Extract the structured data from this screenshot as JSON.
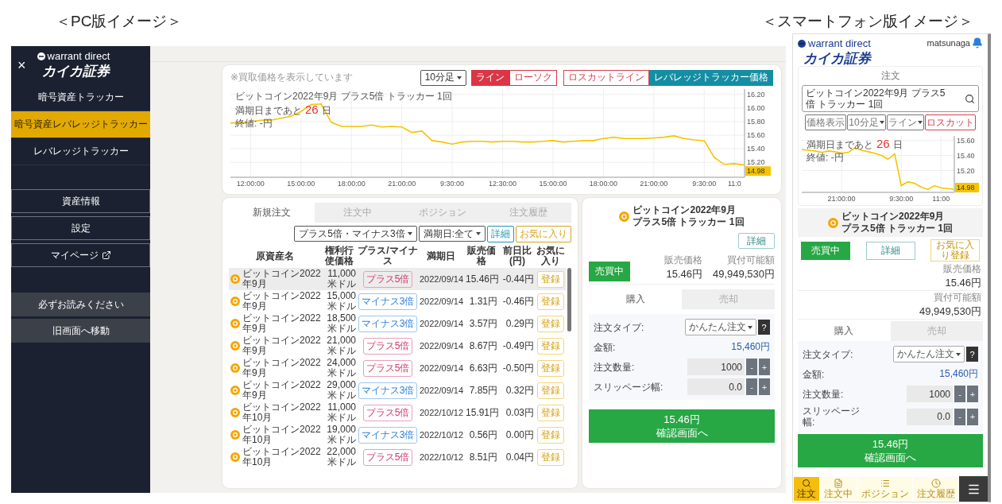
{
  "pc_heading": "＜PC版イメージ＞",
  "sp_heading": "＜スマートフォン版イメージ＞",
  "pc": {
    "sidebar": {
      "close": "×",
      "logo_top": "warrant direct",
      "logo_name": "カイカ証券",
      "nav": [
        {
          "label": "暗号資産トラッカー",
          "selected": false
        },
        {
          "label": "暗号資産レバレッジトラッカー",
          "selected": true
        },
        {
          "label": "レバレッジトラッカー",
          "selected": false
        }
      ],
      "menu": [
        {
          "label": "資産情報",
          "kind": "plain"
        },
        {
          "label": "設定",
          "kind": "plain"
        },
        {
          "label": "マイページ",
          "kind": "external"
        }
      ],
      "links": [
        "必ずお読みください",
        "旧画面へ移動"
      ]
    },
    "chart_card": {
      "note": "※買取価格を表示しています",
      "interval": "10分足",
      "styles": [
        {
          "label": "ライン",
          "selected": true
        },
        {
          "label": "ローソク",
          "selected": false
        }
      ],
      "lines": [
        {
          "label": "ロスカットライン",
          "selected": false
        },
        {
          "label": "レバレッジトラッカー価格",
          "selected": true
        }
      ],
      "title": "ビットコイン2022年9月 プラス5倍 トラッカー 1回",
      "remaining": {
        "before": "満期日まであと",
        "days": "26",
        "after": "日"
      },
      "close": "終値: -円",
      "chart_data": {
        "type": "line",
        "categories": [
          null,
          null,
          "12:00:00",
          null,
          null,
          null,
          null,
          "15:00:00",
          null,
          null,
          null,
          null,
          "18:00:00",
          null,
          null,
          null,
          null,
          "21:00:00",
          null,
          null,
          null,
          null,
          "9:30:00",
          null,
          null,
          null,
          null,
          "12:30:00",
          null,
          null,
          null,
          null,
          "15:00:00",
          null,
          null,
          null,
          null,
          "18:00:00",
          null,
          null,
          null,
          null,
          "21:00:00",
          null,
          null,
          null,
          null,
          "9:30:00",
          null,
          null,
          "11:0",
          null
        ],
        "values": [
          15.78,
          15.78,
          15.8,
          15.82,
          15.82,
          15.85,
          15.88,
          15.95,
          16.05,
          16.06,
          15.79,
          15.73,
          15.73,
          15.73,
          15.75,
          15.72,
          15.73,
          15.72,
          15.64,
          15.66,
          15.52,
          15.5,
          15.47,
          15.5,
          15.51,
          15.51,
          15.5,
          15.51,
          15.51,
          15.5,
          15.5,
          15.51,
          15.52,
          15.5,
          15.51,
          15.52,
          15.52,
          15.55,
          15.57,
          15.55,
          15.55,
          15.55,
          15.56,
          15.57,
          15.59,
          15.55,
          15.53,
          15.52,
          15.27,
          15.17,
          15.18,
          15.16
        ],
        "ylim": [
          14.98,
          16.28
        ],
        "grid": true,
        "yticks": [
          {
            "value": 15.2,
            "label": "15.20"
          },
          {
            "value": 15.4,
            "label": "15.40"
          },
          {
            "value": 15.6,
            "label": "15.60"
          },
          {
            "value": 15.8,
            "label": "15.80"
          },
          {
            "value": 16.0,
            "label": "16.00"
          },
          {
            "value": 16.2,
            "label": "16.20"
          }
        ],
        "annotations": [
          "14.98"
        ]
      }
    },
    "table_card": {
      "tabs": [
        {
          "label": "新規注文",
          "selected": true
        },
        {
          "label": "注文中",
          "selected": false
        },
        {
          "label": "ポジション",
          "selected": false
        },
        {
          "label": "注文履歴",
          "selected": false
        }
      ],
      "filters": {
        "type": "プラス5倍・マイナス3倍",
        "expiry": "満期日:全て",
        "detail": "詳細",
        "favorite": "お気に入り"
      },
      "columns": [
        "原資産名",
        "権利行使価格",
        "プラス/マイナス",
        "満期日",
        "販売価格",
        "前日比(円)",
        "お気に入り"
      ],
      "rows": [
        {
          "name": "ビットコイン2022年9月",
          "strike": "11,000米ドル",
          "type": {
            "label": "プラス5倍",
            "kind": "plus"
          },
          "expiry": "2022/09/14",
          "price": "15.46円",
          "change": "-0.44円",
          "favorite": "登録",
          "selected": true
        },
        {
          "name": "ビットコイン2022年9月",
          "strike": "15,000米ドル",
          "type": {
            "label": "マイナス3倍",
            "kind": "minus"
          },
          "expiry": "2022/09/14",
          "price": "1.31円",
          "change": "-0.46円",
          "favorite": "登録",
          "selected": false
        },
        {
          "name": "ビットコイン2022年9月",
          "strike": "18,500米ドル",
          "type": {
            "label": "マイナス3倍",
            "kind": "minus"
          },
          "expiry": "2022/09/14",
          "price": "3.57円",
          "change": "0.29円",
          "favorite": "登録",
          "selected": false
        },
        {
          "name": "ビットコイン2022年9月",
          "strike": "21,000米ドル",
          "type": {
            "label": "プラス5倍",
            "kind": "plus"
          },
          "expiry": "2022/09/14",
          "price": "8.67円",
          "change": "-0.49円",
          "favorite": "登録",
          "selected": false
        },
        {
          "name": "ビットコイン2022年9月",
          "strike": "24,000米ドル",
          "type": {
            "label": "プラス5倍",
            "kind": "plus"
          },
          "expiry": "2022/09/14",
          "price": "6.63円",
          "change": "-0.50円",
          "favorite": "登録",
          "selected": false
        },
        {
          "name": "ビットコイン2022年9月",
          "strike": "29,000米ドル",
          "type": {
            "label": "マイナス3倍",
            "kind": "minus"
          },
          "expiry": "2022/09/14",
          "price": "7.85円",
          "change": "0.32円",
          "favorite": "登録",
          "selected": false
        },
        {
          "name": "ビットコイン2022年10月",
          "strike": "11,000米ドル",
          "type": {
            "label": "プラス5倍",
            "kind": "plus"
          },
          "expiry": "2022/10/12",
          "price": "15.91円",
          "change": "0.03円",
          "favorite": "登録",
          "selected": false
        },
        {
          "name": "ビットコイン2022年10月",
          "strike": "19,000米ドル",
          "type": {
            "label": "マイナス3倍",
            "kind": "minus"
          },
          "expiry": "2022/10/12",
          "price": "0.56円",
          "change": "0.00円",
          "favorite": "登録",
          "selected": false
        },
        {
          "name": "ビットコイン2022年10月",
          "strike": "22,000米ドル",
          "type": {
            "label": "プラス5倍",
            "kind": "plus"
          },
          "expiry": "2022/10/12",
          "price": "8.51円",
          "change": "0.04円",
          "favorite": "登録",
          "selected": false
        }
      ]
    },
    "order_card": {
      "title": [
        "ビットコイン2022年9月",
        "プラス5倍 トラッカー 1回"
      ],
      "detail": "詳細",
      "status": "売買中",
      "stats": [
        {
          "label": "販売価格",
          "value": "15.46円"
        },
        {
          "label": "買付可能額",
          "value": "49,949,530円"
        }
      ],
      "tabs": [
        {
          "label": "購入",
          "selected": true
        },
        {
          "label": "売却",
          "selected": false
        }
      ],
      "form": [
        {
          "kind": "select",
          "label": "注文タイプ:",
          "value": "かんたん注文",
          "help": "?"
        },
        {
          "kind": "amount",
          "label": "金額:",
          "value": "15,460円"
        },
        {
          "kind": "stepper",
          "label": "注文数量:",
          "value": "1000",
          "minus": "-",
          "plus": "+"
        },
        {
          "kind": "stepper",
          "label": "スリッページ幅:",
          "value": "0.0",
          "minus": "-",
          "plus": "+"
        }
      ],
      "submit": {
        "price": "15.46円",
        "label": "確認画面へ"
      }
    }
  },
  "sp": {
    "logo_top": "warrant direct",
    "logo_name": "カイカ証券",
    "user": "matsunaga",
    "section": "注文",
    "search": "ビットコイン2022年9月 プラス5倍 トラッカー 1回",
    "toolbar": [
      {
        "label": "価格表示",
        "kind": "plain"
      },
      {
        "label": "10分足",
        "kind": "dropdown"
      },
      {
        "label": "ライン",
        "kind": "dropdown"
      },
      {
        "label": "ロスカット",
        "kind": "alert"
      }
    ],
    "remaining": {
      "before": "満期日まであと",
      "days": "26",
      "after": "日"
    },
    "close": "終値: -円",
    "chart_data": {
      "type": "line",
      "categories": [
        null,
        null,
        null,
        null,
        null,
        null,
        "21:00:00",
        null,
        null,
        null,
        null,
        null,
        null,
        null,
        null,
        "9:30:00",
        null,
        null,
        null,
        null,
        null,
        "11:00",
        null,
        null
      ],
      "values": [
        15.48,
        15.47,
        15.46,
        15.44,
        15.46,
        15.45,
        15.43,
        15.44,
        15.5,
        15.47,
        15.45,
        15.43,
        15.4,
        15.35,
        15.42,
        15.0,
        15.05,
        15.03,
        14.98,
        14.95,
        15.0,
        14.97,
        14.96,
        14.95
      ],
      "ylim": [
        14.91,
        15.66
      ],
      "grid": true,
      "yticks": [
        {
          "value": 15.2,
          "label": "15.20"
        },
        {
          "value": 15.4,
          "label": "15.40"
        },
        {
          "value": 15.6,
          "label": "15.60"
        }
      ],
      "annotations": [
        "14.98"
      ]
    },
    "title": [
      "ビットコイン2022年9月",
      "プラス5倍 トラッカー 1回"
    ],
    "status": "売買中",
    "detail": "詳細",
    "favorite": "お気に入り登録",
    "stats": [
      {
        "label": "販売価格",
        "value": "15.46円"
      },
      {
        "label": "買付可能額",
        "value": "49,949,530円"
      }
    ],
    "tabs": [
      {
        "label": "購入",
        "selected": true
      },
      {
        "label": "売却",
        "selected": false
      }
    ],
    "form": [
      {
        "kind": "select",
        "label": "注文タイプ:",
        "value": "かんたん注文",
        "help": "?"
      },
      {
        "kind": "amount",
        "label": "金額:",
        "value": "15,460円"
      },
      {
        "kind": "stepper",
        "label": "注文数量:",
        "value": "1000",
        "minus": "-",
        "plus": "+"
      },
      {
        "kind": "stepper",
        "label": "スリッページ幅:",
        "value": "0.0",
        "minus": "-",
        "plus": "+"
      }
    ],
    "submit": {
      "price": "15.46円",
      "label": "確認画面へ"
    },
    "nav": [
      {
        "label": "注文",
        "selected": true
      },
      {
        "label": "注文中",
        "selected": false
      },
      {
        "label": "ポジション",
        "selected": false
      },
      {
        "label": "注文履歴",
        "selected": false
      }
    ]
  }
}
